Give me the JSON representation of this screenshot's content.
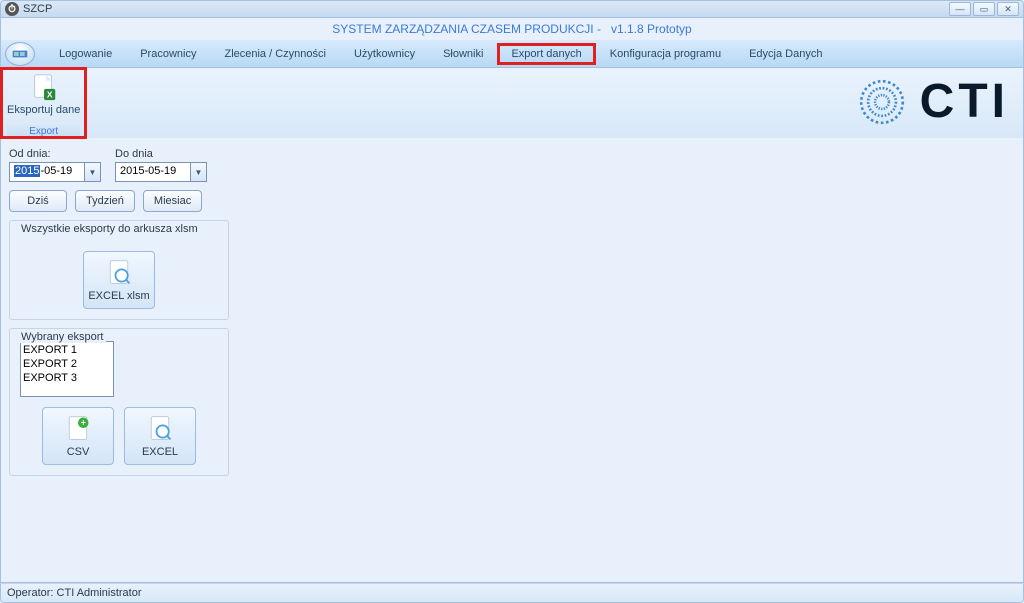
{
  "titlebar": {
    "title": "SZCP"
  },
  "subtitle": {
    "left": "SYSTEM  ZARZĄDZANIA  CZASEM  PRODUKCJI   -",
    "right": "v1.1.8 Prototyp"
  },
  "menu": {
    "items": [
      "Logowanie",
      "Pracownicy",
      "Zlecenia / Czynności",
      "Użytkownicy",
      "Słowniki",
      "Export danych",
      "Konfiguracja programu",
      "Edycja Danych"
    ],
    "highlighted_index": 5
  },
  "ribbon": {
    "group_label": "Export",
    "button_label": "Eksportuj dane"
  },
  "logo_text": "CTI",
  "dates": {
    "from_label": "Od dnia:",
    "from_value_selected": "2015",
    "from_value_rest": "-05-19",
    "to_label": "Do dnia",
    "to_value": "2015-05-19"
  },
  "range_btns": [
    "Dziś",
    "Tydzień",
    "Miesiac"
  ],
  "group_all": {
    "label": "Wszystkie eksporty do arkusza xlsm",
    "btn": "EXCEL xlsm"
  },
  "group_sel": {
    "label": "Wybrany eksport",
    "list": [
      "EXPORT 1",
      "EXPORT 2",
      "EXPORT 3"
    ],
    "btn_csv": "CSV",
    "btn_excel": "EXCEL"
  },
  "status": {
    "prefix": "Operator: ",
    "value": "CTI Administrator"
  }
}
